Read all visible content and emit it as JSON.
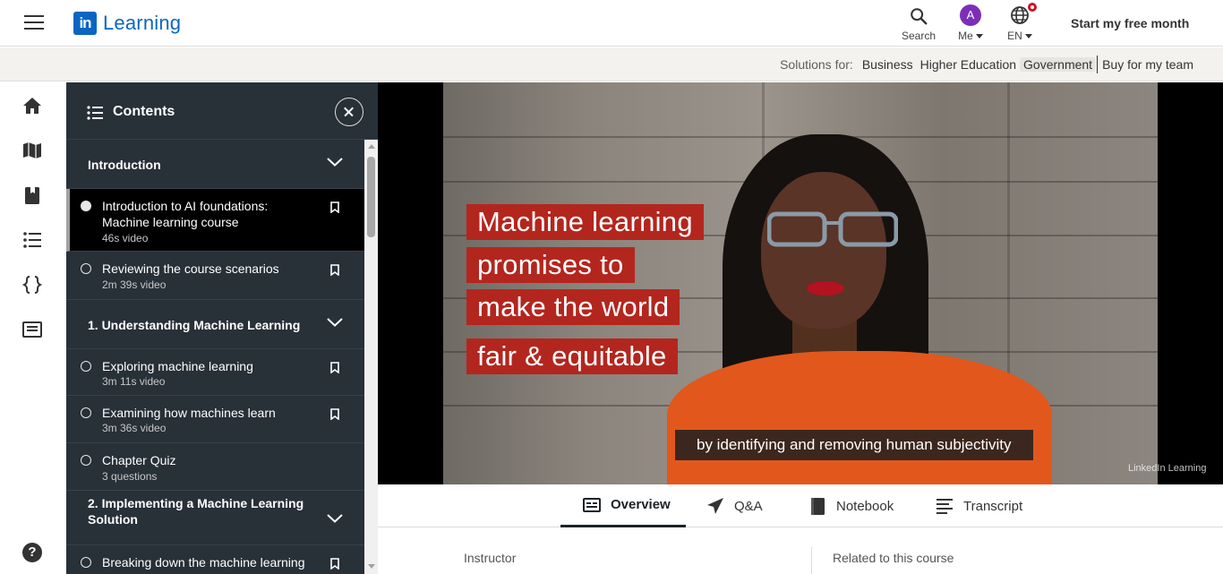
{
  "app": {
    "logo_mark": "in",
    "logo_text": "Learning"
  },
  "topnav": {
    "search_label": "Search",
    "me_label": "Me",
    "avatar_initial": "A",
    "language_label": "EN",
    "cta": "Start my free month"
  },
  "solutions": {
    "label": "Solutions for:",
    "links": [
      "Business",
      "Higher Education",
      "Government"
    ],
    "buy": "Buy for my team"
  },
  "rail": {
    "icons": [
      "home-icon",
      "map-icon",
      "book-icon",
      "contents-list-icon",
      "code-braces-icon",
      "notes-icon"
    ]
  },
  "contents": {
    "title": "Contents",
    "sections": [
      {
        "title": "Introduction"
      },
      {
        "title": "1. Understanding Machine Learning"
      },
      {
        "title": "2. Implementing a Machine Learning Solution"
      }
    ],
    "items": [
      {
        "title": "Introduction to AI foundations: Machine learning course",
        "meta": "46s video"
      },
      {
        "title": "Reviewing the course scenarios",
        "meta": "2m 39s video"
      },
      {
        "title": "Exploring machine learning",
        "meta": "3m 11s video"
      },
      {
        "title": "Examining how machines learn",
        "meta": "3m 36s video"
      },
      {
        "title": "Chapter Quiz",
        "meta": "3 questions"
      },
      {
        "title": "Breaking down the machine learning life cycle",
        "meta": ""
      }
    ]
  },
  "video": {
    "overlay_lines": [
      "Machine learning",
      "promises to",
      "make the world",
      "fair & equitable"
    ],
    "caption": "by identifying and removing human subjectivity",
    "watermark": "LinkedIn Learning"
  },
  "tabs": [
    "Overview",
    "Q&A",
    "Notebook",
    "Transcript"
  ],
  "below": {
    "instructor_label": "Instructor",
    "related_label": "Related to this course"
  },
  "colors": {
    "brand": "#0a66c2",
    "panel": "#283038",
    "overlay_red": "#b3261e",
    "notification": "#d11124"
  }
}
